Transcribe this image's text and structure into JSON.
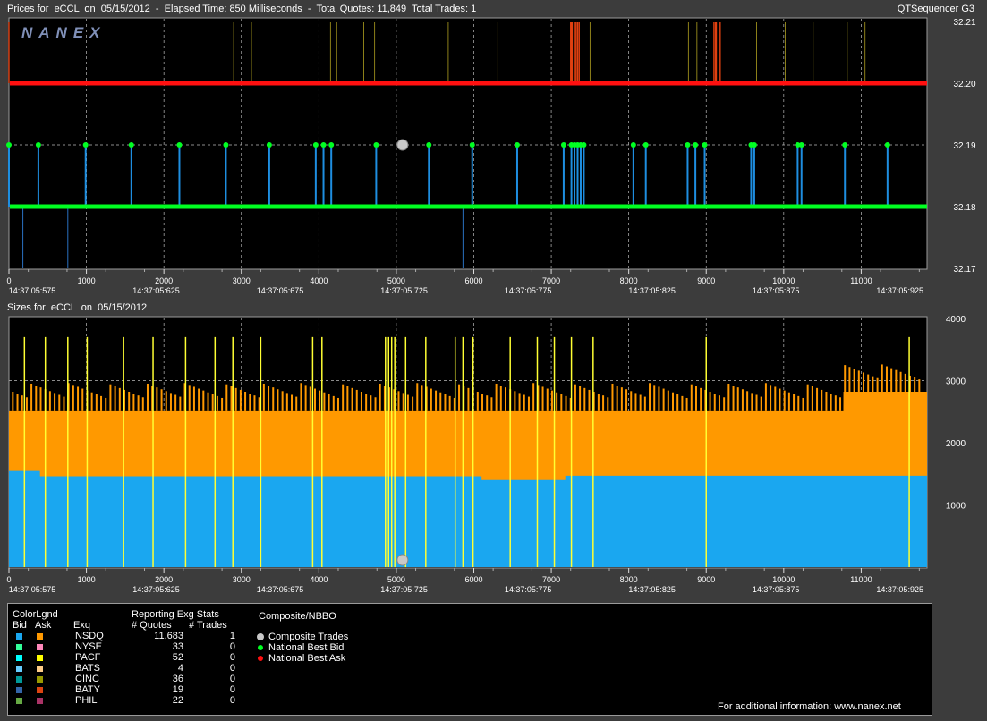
{
  "header": {
    "prices_title": "Prices for  eCCL  on  05/15/2012  -  Elapsed Time: 850 Milliseconds  -  Total Quotes: 11,849  Total Trades: 1",
    "app_name": "QTSequencer G3",
    "sizes_title": "Sizes for  eCCL  on  05/15/2012",
    "logo_text": "NANEX"
  },
  "colors": {
    "bid_line": "#00ff22",
    "ask_line": "#ff1010",
    "nsdq_bid": "#1aa7f0",
    "nsdq_ask": "#ff9900",
    "nyse": "#ffff33",
    "trade": "#c8c8c8"
  },
  "chart_data": [
    {
      "type": "line",
      "name": "prices",
      "xlim": [
        0,
        11850
      ],
      "ylim": [
        32.17,
        32.21
      ],
      "x_ticks": [
        0,
        1000,
        2000,
        3000,
        4000,
        5000,
        6000,
        7000,
        8000,
        9000,
        10000,
        11000
      ],
      "y_ticks": [
        "32.21",
        "32.20",
        "32.19",
        "32.18",
        "32.17"
      ],
      "time_ticks": [
        {
          "x": 300,
          "label": "14:37:05:575"
        },
        {
          "x": 1900,
          "label": "14:37:05:625"
        },
        {
          "x": 3500,
          "label": "14:37:05:675"
        },
        {
          "x": 5100,
          "label": "14:37:05:725"
        },
        {
          "x": 6700,
          "label": "14:37:05:775"
        },
        {
          "x": 8300,
          "label": "14:37:05:825"
        },
        {
          "x": 9900,
          "label": "14:37:05:875"
        },
        {
          "x": 11500,
          "label": "14:37:05:925"
        }
      ],
      "national_best_ask": 32.2,
      "national_best_bid": 32.18,
      "composite_trade": {
        "x": 5080,
        "price": 32.19
      },
      "bid_markers_x": [
        0,
        380,
        990,
        1580,
        2200,
        2800,
        3360,
        3960,
        4060,
        4160,
        4740,
        5420,
        5980,
        6560,
        7160,
        7260,
        7300,
        7340,
        7380,
        7420,
        8060,
        8220,
        8760,
        8860,
        8980,
        9580,
        9620,
        10180,
        10230,
        10790,
        11340
      ],
      "ask_spikes_x": [
        0,
        2900,
        3130,
        4150,
        4230,
        4580,
        4720,
        5670,
        6310,
        7250,
        7260,
        7270,
        7300,
        7320,
        7340,
        7360,
        7500,
        8770,
        8880,
        9100,
        9120,
        9130,
        9180,
        9650,
        10020,
        10380,
        10820,
        11050
      ]
    },
    {
      "type": "area",
      "name": "sizes",
      "xlim": [
        0,
        11850
      ],
      "ylim": [
        0,
        4000
      ],
      "x_ticks": [
        0,
        1000,
        2000,
        3000,
        4000,
        5000,
        6000,
        7000,
        8000,
        9000,
        10000,
        11000
      ],
      "y_ticks": [
        4000,
        3000,
        2000,
        1000
      ],
      "series": [
        {
          "name": "NSDQ Bid",
          "x": [
            0,
            400,
            401,
            6100,
            6101,
            7180,
            7181,
            11850
          ],
          "values": [
            1560,
            1560,
            1460,
            1460,
            1400,
            1400,
            1470,
            1470
          ]
        },
        {
          "name": "NSDQ Ask",
          "x": [
            0,
            6100,
            6101,
            10770,
            10771,
            11850
          ],
          "values": [
            2520,
            2520,
            2520,
            2520,
            2820,
            2820
          ]
        }
      ],
      "nyse_spikes_x": [
        200,
        470,
        760,
        1010,
        1480,
        1860,
        2280,
        2660,
        2890,
        3250,
        3920,
        4040,
        4860,
        4900,
        4940,
        4980,
        5120,
        5380,
        5760,
        5860,
        5990,
        6470,
        6820,
        7040,
        7260,
        7540,
        9000,
        11620
      ],
      "time_ticks": [
        {
          "x": 300,
          "label": "14:37:05:575"
        },
        {
          "x": 1900,
          "label": "14:37:05:625"
        },
        {
          "x": 3500,
          "label": "14:37:05:675"
        },
        {
          "x": 5100,
          "label": "14:37:05:725"
        },
        {
          "x": 6700,
          "label": "14:37:05:775"
        },
        {
          "x": 8300,
          "label": "14:37:05:825"
        },
        {
          "x": 9900,
          "label": "14:37:05:875"
        },
        {
          "x": 11500,
          "label": "14:37:05:925"
        }
      ]
    }
  ],
  "legend": {
    "color_legend_title": "ColorLgnd",
    "bid_label": "Bid",
    "ask_label": "Ask",
    "exq_label": "Exq",
    "stats_title": "Reporting Exg Stats",
    "quotes_label": "# Quotes",
    "trades_label": "# Trades",
    "composite_title": "Composite/NBBO",
    "composite_items": [
      "Composite Trades",
      "National Best Bid",
      "National Best Ask"
    ],
    "exchanges": [
      {
        "name": "NSDQ",
        "quotes": "11,683",
        "trades": "1",
        "bid_color": "#1aa7f0",
        "ask_color": "#ff9900"
      },
      {
        "name": "NYSE",
        "quotes": "33",
        "trades": "0",
        "bid_color": "#33ff99",
        "ask_color": "#ff88bb"
      },
      {
        "name": "PACF",
        "quotes": "52",
        "trades": "0",
        "bid_color": "#00ffff",
        "ask_color": "#ffff00"
      },
      {
        "name": "BATS",
        "quotes": "4",
        "trades": "0",
        "bid_color": "#66ccff",
        "ask_color": "#ffcc88"
      },
      {
        "name": "CINC",
        "quotes": "36",
        "trades": "0",
        "bid_color": "#009999",
        "ask_color": "#999900"
      },
      {
        "name": "BATY",
        "quotes": "19",
        "trades": "0",
        "bid_color": "#3366aa",
        "ask_color": "#dd4411"
      },
      {
        "name": "PHIL",
        "quotes": "22",
        "trades": "0",
        "bid_color": "#66aa44",
        "ask_color": "#aa3366"
      }
    ],
    "footer": "For additional information: www.nanex.net"
  }
}
